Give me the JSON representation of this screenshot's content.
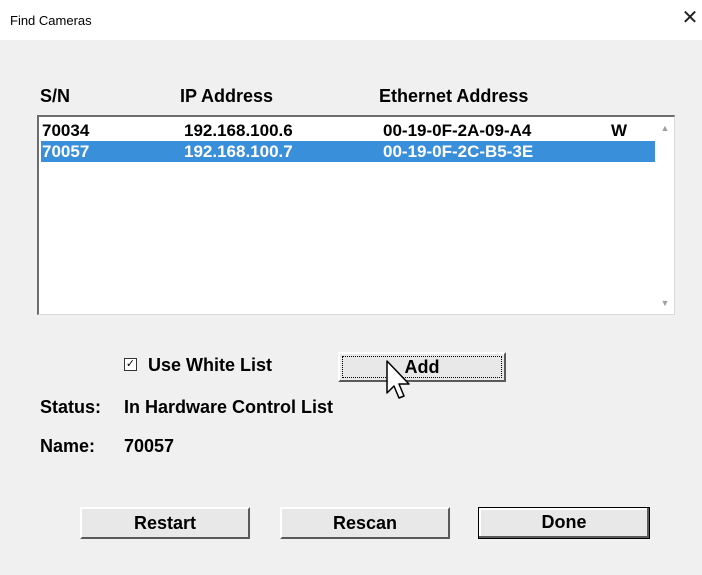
{
  "window": {
    "title": "Find Cameras",
    "close_glyph": "✕"
  },
  "columns": {
    "sn": "S/N",
    "ip": "IP Address",
    "eth": "Ethernet Address"
  },
  "rows": [
    {
      "sn": "70034",
      "ip": "192.168.100.6",
      "eth": "00-19-0F-2A-09-A4",
      "flag": "W",
      "selected": false
    },
    {
      "sn": "70057",
      "ip": "192.168.100.7",
      "eth": "00-19-0F-2C-B5-3E",
      "flag": "",
      "selected": true
    }
  ],
  "white_list": {
    "label": "Use White List",
    "checked": true,
    "check_glyph": "✓"
  },
  "add_button": "Add",
  "status": {
    "label": "Status:",
    "value": "In Hardware Control List"
  },
  "name": {
    "label": "Name:",
    "value": "70057"
  },
  "buttons": {
    "restart": "Restart",
    "rescan": "Rescan",
    "done": "Done"
  },
  "colors": {
    "selection": "#3a8fdb",
    "background": "#f0f0f0"
  }
}
